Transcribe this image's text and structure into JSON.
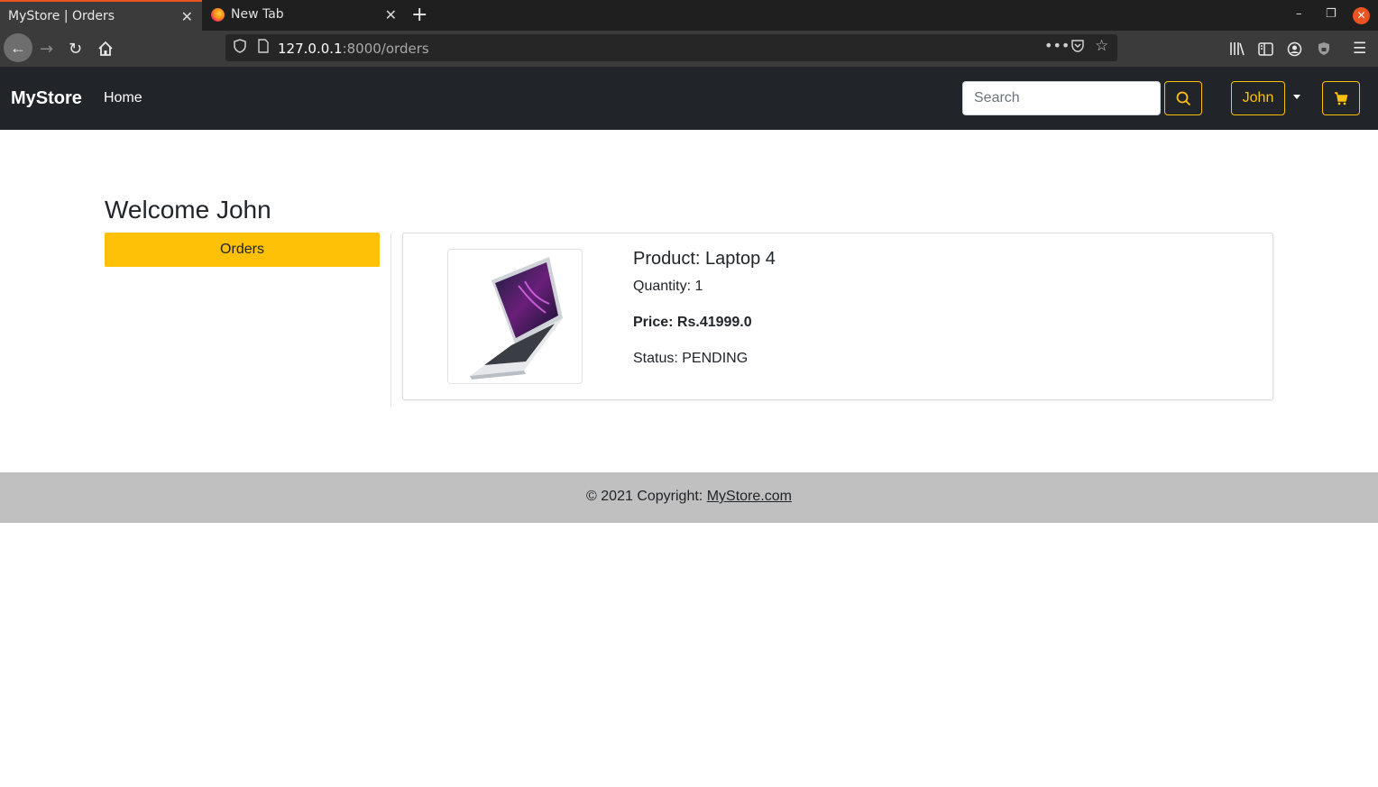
{
  "browser": {
    "tabs": [
      {
        "label": "MyStore | Orders",
        "active": true
      },
      {
        "label": "New Tab",
        "active": false
      }
    ],
    "url_host": "127.0.0.1",
    "url_path": ":8000/orders"
  },
  "navbar": {
    "brand": "MyStore",
    "home_label": "Home",
    "search_placeholder": "Search",
    "user_label": "John",
    "accent_color": "#ffc107",
    "bg_color": "#212529"
  },
  "main": {
    "welcome": "Welcome John",
    "orders_button": "Orders",
    "order": {
      "product": "Product: Laptop 4",
      "quantity": "Quantity: 1",
      "price": "Price: Rs.41999.0",
      "status": "Status: PENDING"
    }
  },
  "footer": {
    "text": "© 2021 Copyright: ",
    "link": "MyStore.com",
    "bg_color": "#c0c0c0"
  }
}
